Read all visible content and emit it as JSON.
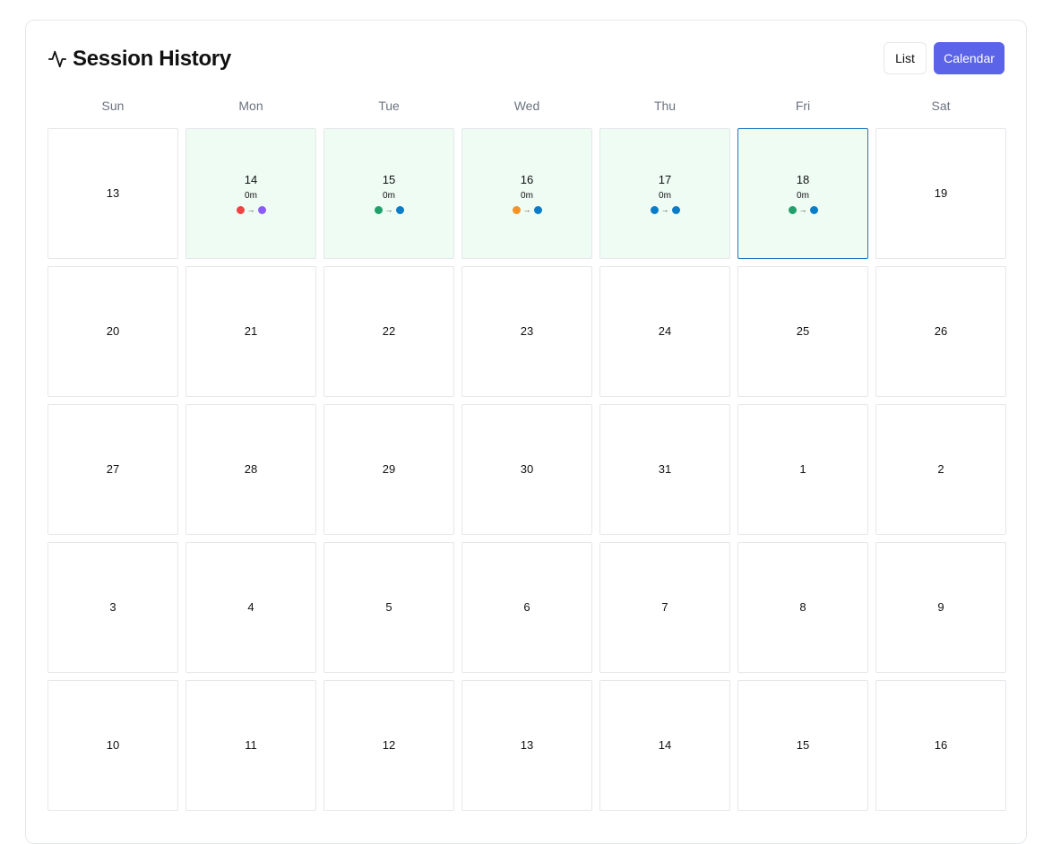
{
  "header": {
    "title": "Session History",
    "icon": "activity-icon",
    "views": {
      "list_label": "List",
      "calendar_label": "Calendar",
      "selected": "Calendar"
    }
  },
  "colors": {
    "accent": "#5b63e8",
    "active_bg": "#effcf3",
    "today_border": "#1d74c4"
  },
  "calendar": {
    "weekdays": [
      "Sun",
      "Mon",
      "Tue",
      "Wed",
      "Thu",
      "Fri",
      "Sat"
    ],
    "days": [
      {
        "day": "13"
      },
      {
        "day": "14",
        "duration": "0m",
        "from": "#ef4444",
        "to": "#8b5cf6"
      },
      {
        "day": "15",
        "duration": "0m",
        "from": "#22a06b",
        "to": "#0b7cc8"
      },
      {
        "day": "16",
        "duration": "0m",
        "from": "#f59322",
        "to": "#0b7cc8"
      },
      {
        "day": "17",
        "duration": "0m",
        "from": "#0b7cc8",
        "to": "#0b7cc8"
      },
      {
        "day": "18",
        "duration": "0m",
        "from": "#22a06b",
        "to": "#0b7cc8",
        "today": true
      },
      {
        "day": "19"
      },
      {
        "day": "20"
      },
      {
        "day": "21"
      },
      {
        "day": "22"
      },
      {
        "day": "23"
      },
      {
        "day": "24"
      },
      {
        "day": "25"
      },
      {
        "day": "26"
      },
      {
        "day": "27"
      },
      {
        "day": "28"
      },
      {
        "day": "29"
      },
      {
        "day": "30"
      },
      {
        "day": "31"
      },
      {
        "day": "1"
      },
      {
        "day": "2"
      },
      {
        "day": "3"
      },
      {
        "day": "4"
      },
      {
        "day": "5"
      },
      {
        "day": "6"
      },
      {
        "day": "7"
      },
      {
        "day": "8"
      },
      {
        "day": "9"
      },
      {
        "day": "10"
      },
      {
        "day": "11"
      },
      {
        "day": "12"
      },
      {
        "day": "13"
      },
      {
        "day": "14"
      },
      {
        "day": "15"
      },
      {
        "day": "16"
      }
    ]
  }
}
